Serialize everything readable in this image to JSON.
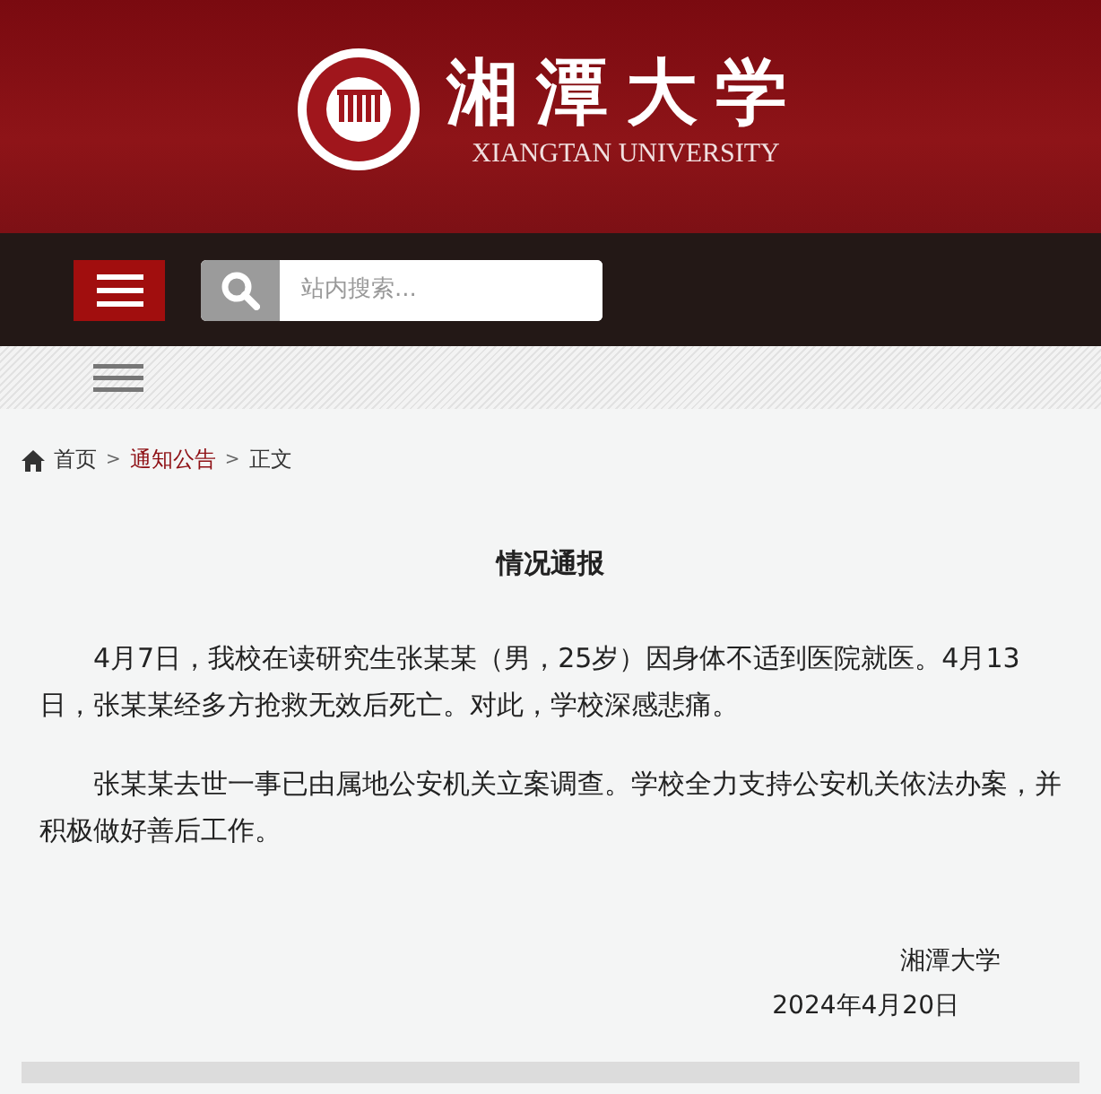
{
  "header": {
    "name": "湘潭大学",
    "name_en": "XIANGTAN UNIVERSITY"
  },
  "search": {
    "placeholder": "站内搜索..."
  },
  "breadcrumb": [
    {
      "label": "首页",
      "selected": false
    },
    {
      "label": "通知公告",
      "selected": true
    },
    {
      "label": "正文",
      "selected": false
    }
  ],
  "breadcrumb_separator": ">",
  "article": {
    "title": "情况通报",
    "paragraphs": [
      "4月7日，我校在读研究生张某某（男，25岁）因身体不适到医院就医。4月13日，张某某经多方抢救无效后死亡。对此，学校深感悲痛。",
      "张某某去世一事已由属地公安机关立案调查。学校全力支持公安机关依法办案，并积极做好善后工作。"
    ],
    "signature": "湘潭大学",
    "date": "2024年4月20日"
  }
}
